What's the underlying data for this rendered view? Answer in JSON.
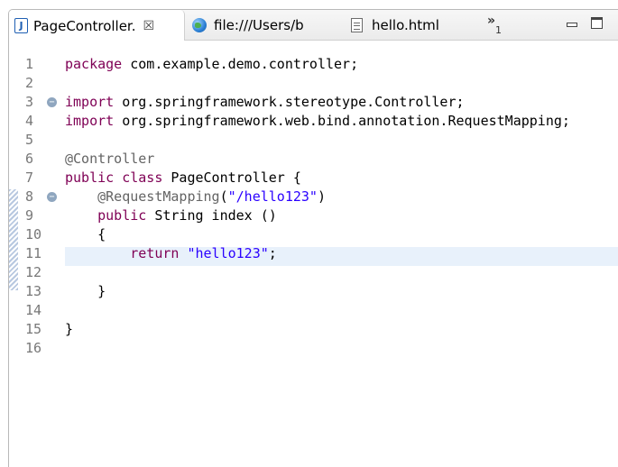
{
  "tabs": [
    {
      "label": "PageController.",
      "close": "☒",
      "icon": "java-file-icon",
      "active": true
    },
    {
      "label": "file:///Users/b",
      "icon": "globe-icon",
      "active": false
    },
    {
      "label": "hello.html",
      "icon": "html-file-icon",
      "active": false
    }
  ],
  "overflow": {
    "label": "»",
    "count": "1"
  },
  "code_lines": [
    {
      "n": "1",
      "parts": [
        [
          "kw",
          "package"
        ],
        [
          "t",
          " com.example.demo.controller;"
        ]
      ]
    },
    {
      "n": "2",
      "parts": []
    },
    {
      "n": "3",
      "fold": true,
      "parts": [
        [
          "kw",
          "import"
        ],
        [
          "t",
          " org.springframework.stereotype.Controller;"
        ]
      ]
    },
    {
      "n": "4",
      "parts": [
        [
          "kw",
          "import"
        ],
        [
          "t",
          " org.springframework.web.bind.annotation.RequestMapping;"
        ]
      ]
    },
    {
      "n": "5",
      "parts": []
    },
    {
      "n": "6",
      "parts": [
        [
          "ann",
          "@Controller"
        ]
      ]
    },
    {
      "n": "7",
      "parts": [
        [
          "kw",
          "public"
        ],
        [
          "t",
          " "
        ],
        [
          "kw",
          "class"
        ],
        [
          "t",
          " PageController {"
        ]
      ]
    },
    {
      "n": "8",
      "fold": true,
      "parts": [
        [
          "t",
          "    "
        ],
        [
          "ann",
          "@RequestMapping"
        ],
        [
          "t",
          "("
        ],
        [
          "str",
          "\"/hello123\""
        ],
        [
          "t",
          ")"
        ]
      ]
    },
    {
      "n": "9",
      "parts": [
        [
          "t",
          "    "
        ],
        [
          "kw",
          "public"
        ],
        [
          "t",
          " String index ()"
        ]
      ]
    },
    {
      "n": "10",
      "parts": [
        [
          "t",
          "    {"
        ]
      ]
    },
    {
      "n": "11",
      "parts": [
        [
          "t",
          "        "
        ],
        [
          "kw",
          "return"
        ],
        [
          "t",
          " "
        ],
        [
          "str",
          "\"hello123\""
        ],
        [
          "t",
          ";"
        ]
      ]
    },
    {
      "n": "12",
      "parts": []
    },
    {
      "n": "13",
      "parts": [
        [
          "t",
          "    }"
        ]
      ]
    },
    {
      "n": "14",
      "parts": []
    },
    {
      "n": "15",
      "parts": [
        [
          "t",
          "}"
        ]
      ]
    },
    {
      "n": "16",
      "parts": []
    }
  ]
}
